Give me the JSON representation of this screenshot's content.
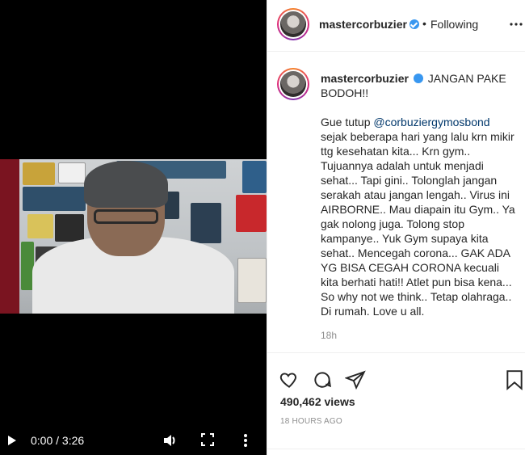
{
  "post": {
    "username": "mastercorbuzier",
    "follow_status": "Following",
    "separator": "•",
    "caption_title": "JANGAN PAKE BODOH!!",
    "caption_intro": "Gue tutup ",
    "mention": "@corbuziergymosbond",
    "caption_text": "sejak beberapa hari yang lalu krn mikir ttg kesehatan kita... Krn gym.. Tujuannya adalah untuk menjadi sehat... Tapi gini.. Tolonglah jangan serakah atau jangan lengah.. Virus ini AIRBORNE.. Mau diapain itu Gym.. Ya gak nolong juga. Tolong stop kampanye.. Yuk Gym supaya kita sehat.. Mencegah corona... GAK ADA YG BISA CEGAH CORONA kecuali kita berhati hati!! Atlet pun bisa kena... So why not we think.. Tetap olahraga.. Di rumah. Love u all.",
    "caption_age": "18h",
    "views": "490,462 views",
    "posted_ago": "18 HOURS AGO"
  },
  "video": {
    "time": "0:00 / 3:26"
  },
  "colors": {
    "verified": "#3897f0",
    "mention": "#00376b",
    "muted": "#8e8e8e"
  },
  "icons": [
    "play-icon",
    "volume-icon",
    "fullscreen-icon",
    "more-vertical-icon",
    "more-horizontal-icon",
    "heart-icon",
    "comment-icon",
    "share-icon",
    "bookmark-icon",
    "verified-icon"
  ]
}
